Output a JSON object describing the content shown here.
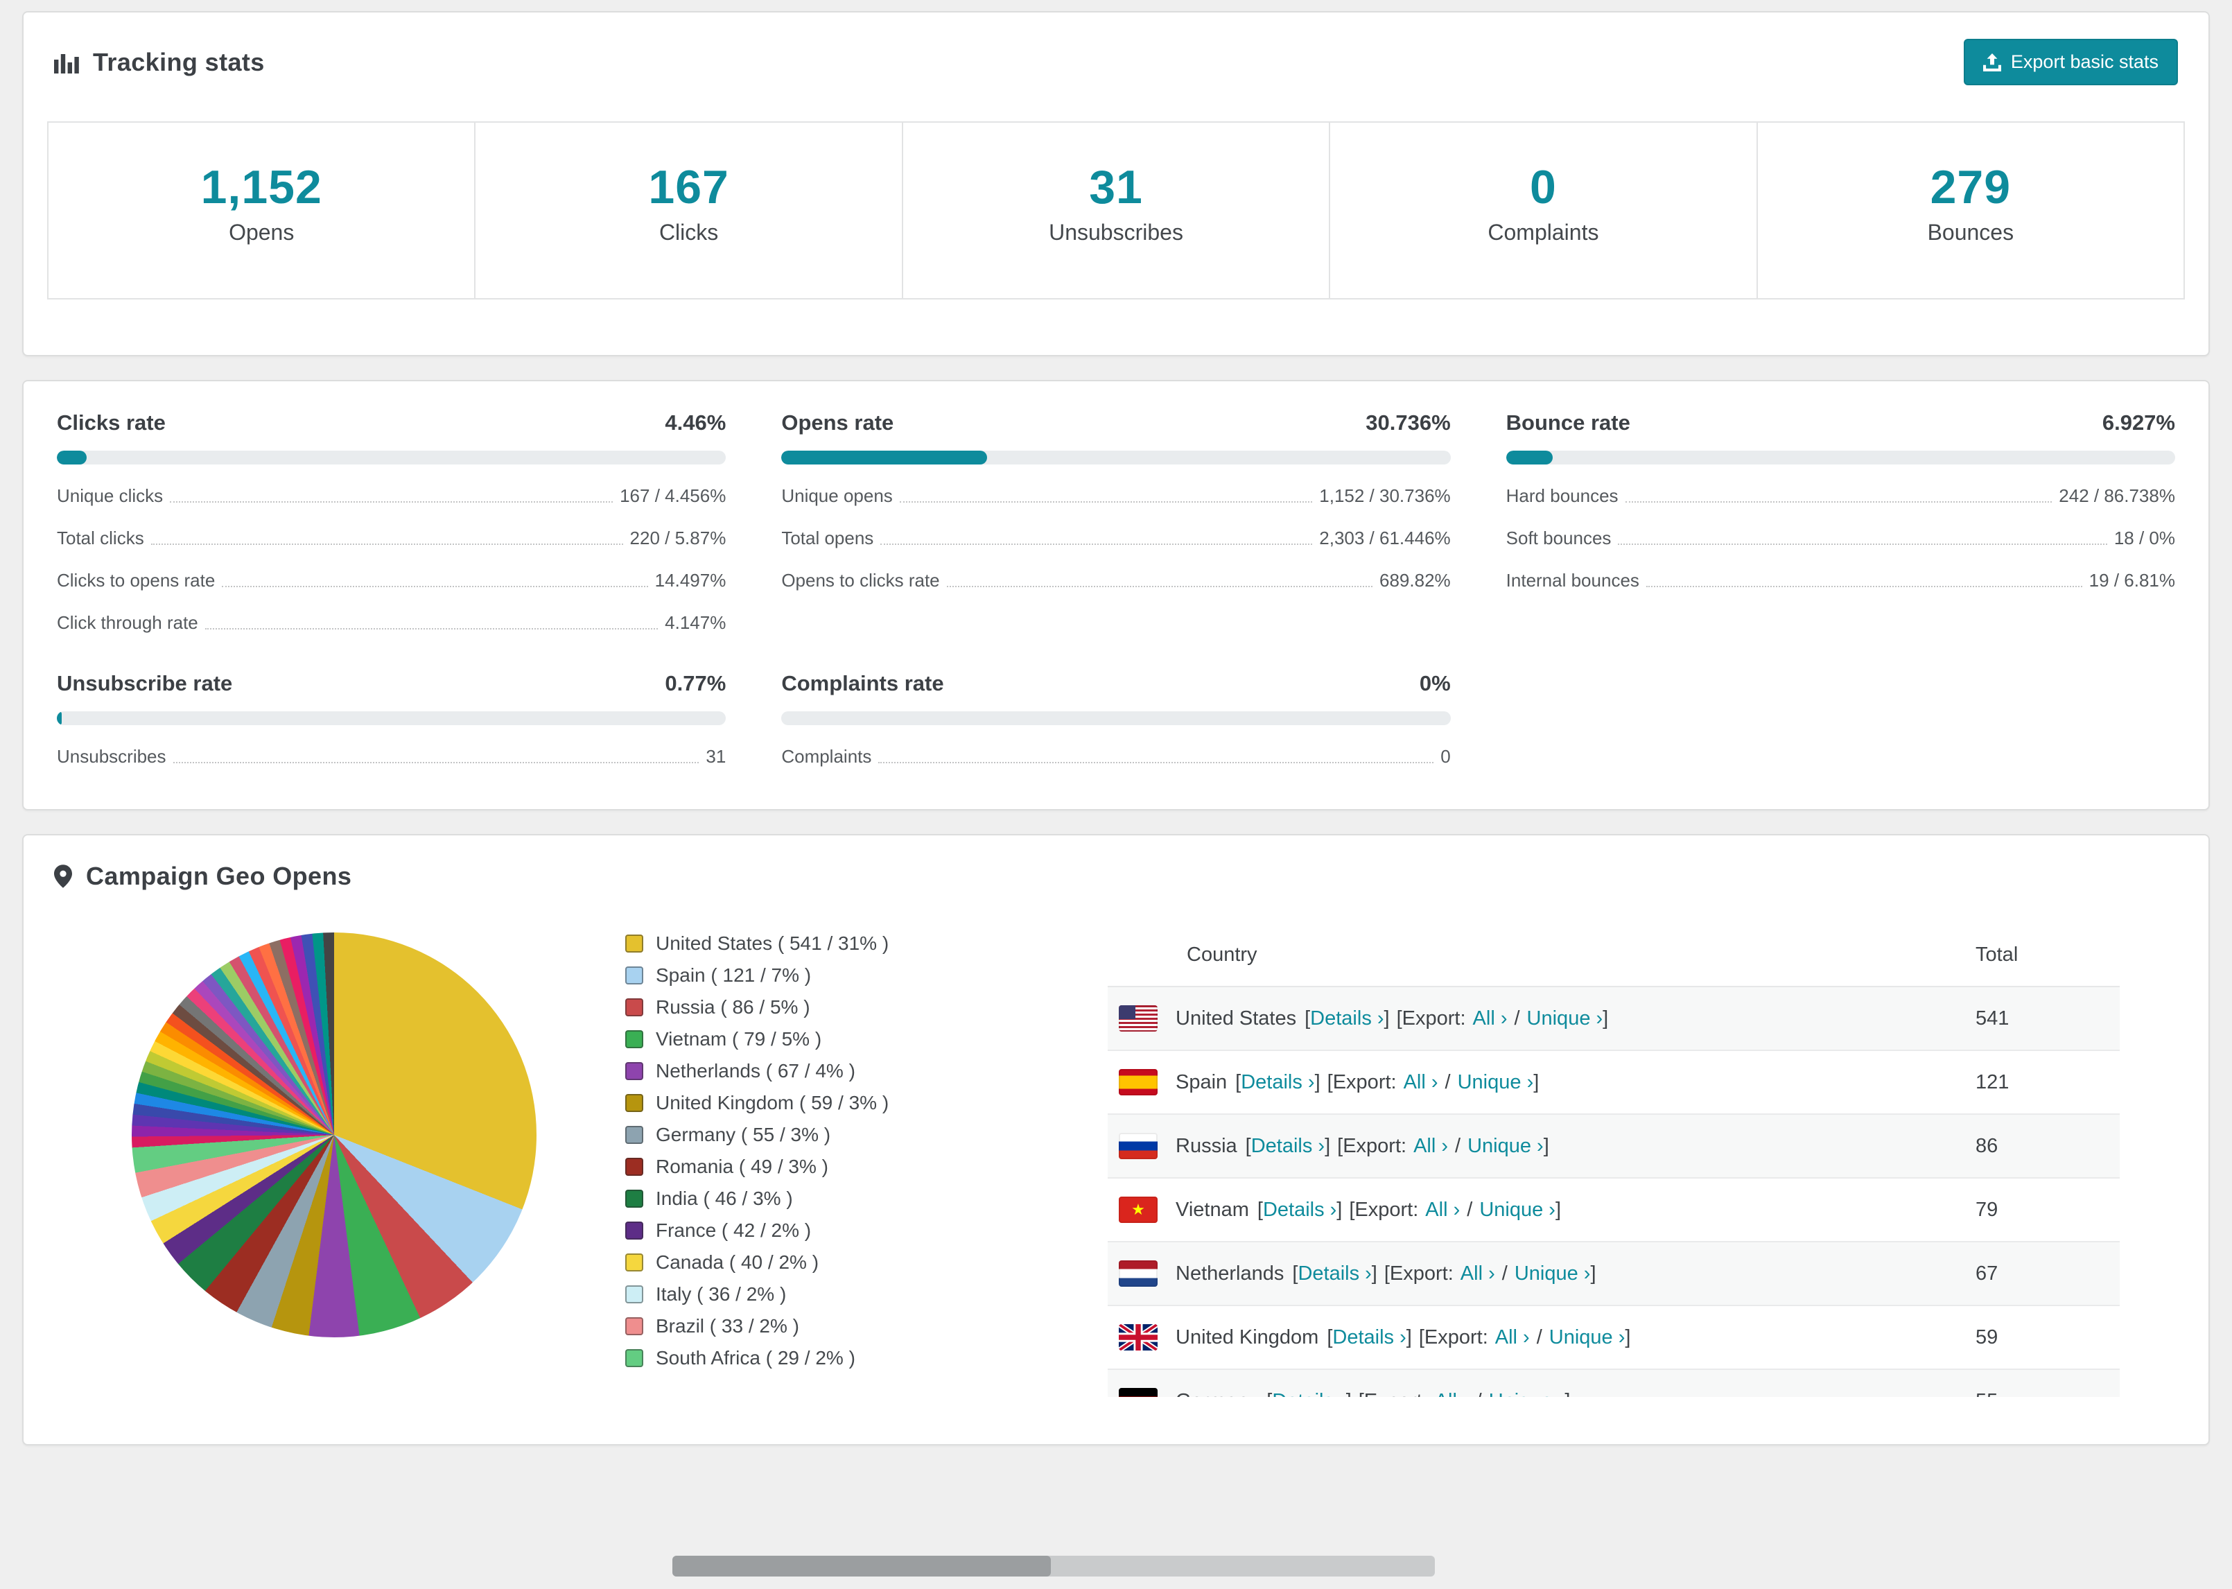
{
  "colors": {
    "accent": "#0e8b9c"
  },
  "tracking": {
    "title": "Tracking stats",
    "export_button": "Export basic stats",
    "stats": [
      {
        "value": "1,152",
        "label": "Opens"
      },
      {
        "value": "167",
        "label": "Clicks"
      },
      {
        "value": "31",
        "label": "Unsubscribes"
      },
      {
        "value": "0",
        "label": "Complaints"
      },
      {
        "value": "279",
        "label": "Bounces"
      }
    ]
  },
  "rates": [
    {
      "title": "Clicks rate",
      "value": "4.46%",
      "pct": 4.46,
      "rows": [
        {
          "label": "Unique clicks",
          "value": "167 / 4.456%"
        },
        {
          "label": "Total clicks",
          "value": "220 / 5.87%"
        },
        {
          "label": "Clicks to opens rate",
          "value": "14.497%"
        },
        {
          "label": "Click through rate",
          "value": "4.147%"
        }
      ]
    },
    {
      "title": "Opens rate",
      "value": "30.736%",
      "pct": 30.736,
      "rows": [
        {
          "label": "Unique opens",
          "value": "1,152 / 30.736%"
        },
        {
          "label": "Total opens",
          "value": "2,303 / 61.446%"
        },
        {
          "label": "Opens to clicks rate",
          "value": "689.82%"
        }
      ]
    },
    {
      "title": "Bounce rate",
      "value": "6.927%",
      "pct": 6.927,
      "rows": [
        {
          "label": "Hard bounces",
          "value": "242 / 86.738%"
        },
        {
          "label": "Soft bounces",
          "value": "18 / 0%"
        },
        {
          "label": "Internal bounces",
          "value": "19 / 6.81%"
        }
      ]
    },
    {
      "title": "Unsubscribe rate",
      "value": "0.77%",
      "pct": 0.77,
      "rows": [
        {
          "label": "Unsubscribes",
          "value": "31"
        }
      ]
    },
    {
      "title": "Complaints rate",
      "value": "0%",
      "pct": 0,
      "rows": [
        {
          "label": "Complaints",
          "value": "0"
        }
      ]
    }
  ],
  "geo": {
    "title": "Campaign Geo Opens",
    "table": {
      "country_header": "Country",
      "total_header": "Total",
      "labels": {
        "lb": "[",
        "rb": "]",
        "details": "Details ›",
        "export_open": "[Export:",
        "all": "All ›",
        "slash": "/",
        "unique": "Unique ›"
      }
    }
  },
  "chart_data": {
    "type": "pie",
    "title": "Campaign Geo Opens",
    "series": [
      {
        "name": "United States",
        "value": 541,
        "pct": 31,
        "color": "#e4c12e",
        "label": "United States ( 541 / 31% )"
      },
      {
        "name": "Spain",
        "value": 121,
        "pct": 7,
        "color": "#a8d2f0",
        "label": "Spain ( 121 / 7% )"
      },
      {
        "name": "Russia",
        "value": 86,
        "pct": 5,
        "color": "#c94a4b",
        "label": "Russia ( 86 / 5% )"
      },
      {
        "name": "Vietnam",
        "value": 79,
        "pct": 5,
        "color": "#3aaf54",
        "label": "Vietnam ( 79 / 5% )"
      },
      {
        "name": "Netherlands",
        "value": 67,
        "pct": 4,
        "color": "#8e44ad",
        "label": "Netherlands ( 67 / 4% )"
      },
      {
        "name": "United Kingdom",
        "value": 59,
        "pct": 3,
        "color": "#b6950e",
        "label": "United Kingdom ( 59 / 3% )"
      },
      {
        "name": "Germany",
        "value": 55,
        "pct": 3,
        "color": "#8da3b0",
        "label": "Germany ( 55 / 3% )"
      },
      {
        "name": "Romania",
        "value": 49,
        "pct": 3,
        "color": "#9c2d22",
        "label": "Romania ( 49 / 3% )"
      },
      {
        "name": "India",
        "value": 46,
        "pct": 3,
        "color": "#1e7e43",
        "label": "India ( 46 / 3% )"
      },
      {
        "name": "France",
        "value": 42,
        "pct": 2,
        "color": "#5d2d87",
        "label": "France ( 42 / 2% )"
      },
      {
        "name": "Canada",
        "value": 40,
        "pct": 2,
        "color": "#f5d73e",
        "label": "Canada ( 40 / 2% )"
      },
      {
        "name": "Italy",
        "value": 36,
        "pct": 2,
        "color": "#cdeef5",
        "label": "Italy ( 36 / 2% )"
      },
      {
        "name": "Brazil",
        "value": 33,
        "pct": 2,
        "color": "#ef8e8e",
        "label": "Brazil ( 33 / 2% )"
      },
      {
        "name": "South Africa",
        "value": 29,
        "pct": 2,
        "color": "#63cd82",
        "label": "South Africa ( 29 / 2% )"
      }
    ],
    "others": {
      "pct": 26,
      "colors": [
        "#d81b60",
        "#8e24aa",
        "#5e35b1",
        "#3949ab",
        "#1e88e5",
        "#00897b",
        "#43a047",
        "#7cb342",
        "#c0ca33",
        "#fdd835",
        "#ffb300",
        "#fb8c00",
        "#f4511e",
        "#6d4c41",
        "#757575",
        "#ec407a",
        "#ab47bc",
        "#7e57c2",
        "#26a69a",
        "#9ccc65",
        "#d4526e",
        "#29b6f6",
        "#ef5350",
        "#ff7043",
        "#8d6e63",
        "#e91e63",
        "#9c27b0",
        "#3f51b5",
        "#009688",
        "#444444"
      ]
    }
  }
}
